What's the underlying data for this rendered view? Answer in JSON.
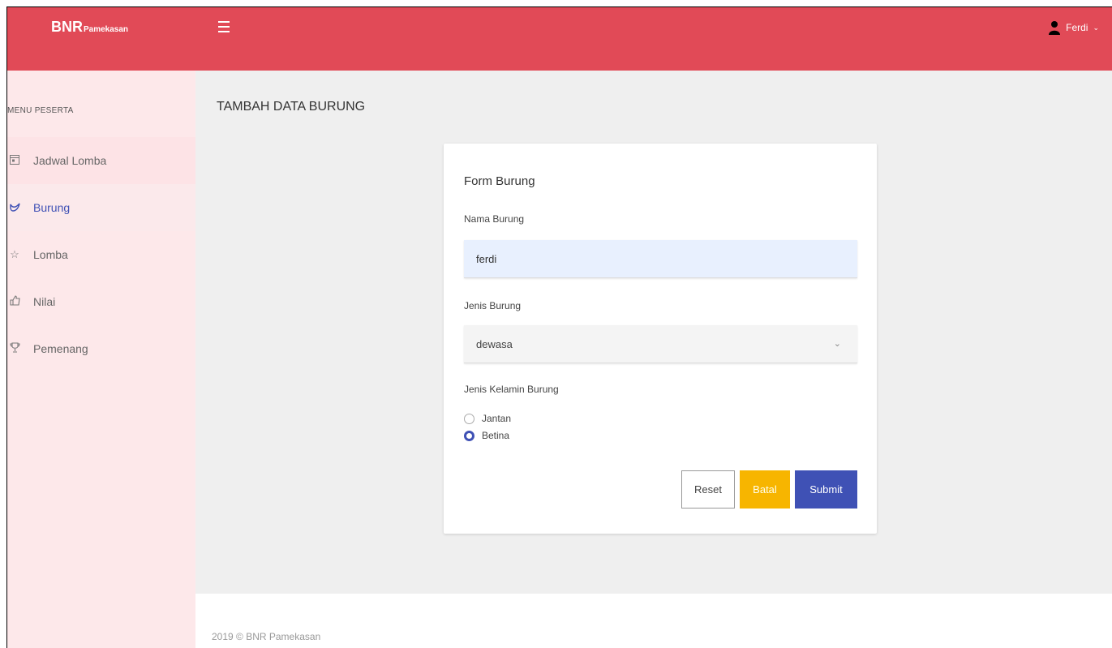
{
  "app": {
    "brand_main": "BNR",
    "brand_sub": "Pamekasan",
    "user_name": "Ferdi"
  },
  "sidebar": {
    "section_title": "MENU PESERTA",
    "items": [
      {
        "label": "Jadwal Lomba",
        "icon": "calendar-icon"
      },
      {
        "label": "Burung",
        "icon": "bird-icon"
      },
      {
        "label": "Lomba",
        "icon": "star-icon"
      },
      {
        "label": "Nilai",
        "icon": "thumbs-up-icon"
      },
      {
        "label": "Pemenang",
        "icon": "trophy-icon"
      }
    ]
  },
  "main": {
    "page_title": "TAMBAH DATA BURUNG",
    "form": {
      "title": "Form Burung",
      "nama_label": "Nama Burung",
      "nama_value": "ferdi",
      "jenis_label": "Jenis Burung",
      "jenis_value": "dewasa",
      "kelamin_label": "Jenis Kelamin Burung",
      "kelamin_options": [
        "Jantan",
        "Betina"
      ],
      "kelamin_selected": "Betina",
      "reset_label": "Reset",
      "batal_label": "Batal",
      "submit_label": "Submit"
    }
  },
  "footer": {
    "text": "2019 © BNR Pamekasan"
  },
  "colors": {
    "topbar": "#e14a57",
    "primary": "#3f51b5",
    "warning": "#f7b500",
    "sidebar_bg": "#fde8ea"
  }
}
